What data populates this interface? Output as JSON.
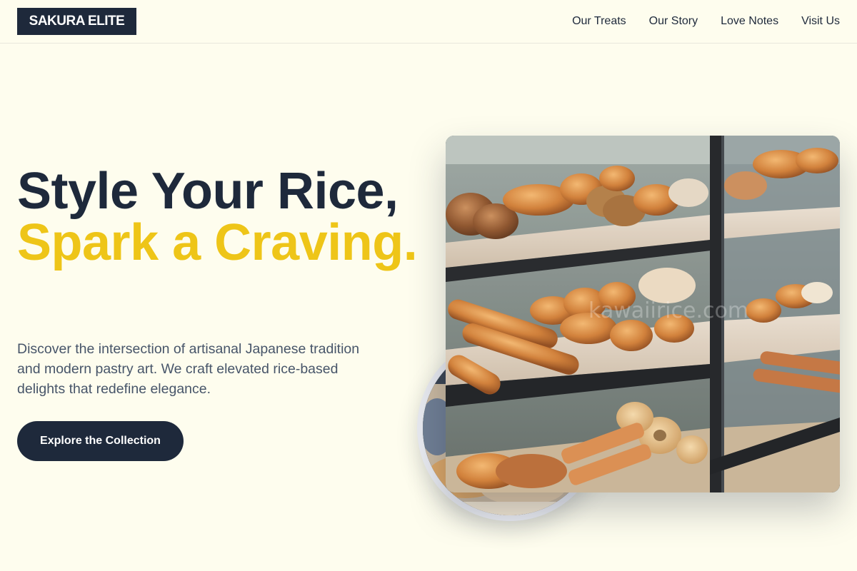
{
  "header": {
    "logo": "SAKURA ELITE",
    "nav": [
      "Our Treats",
      "Our Story",
      "Love Notes",
      "Visit Us"
    ]
  },
  "hero": {
    "title_line1": "Style Your Rice,",
    "title_line2": "Spark a Craving.",
    "description": "Discover the intersection of artisanal Japanese tradition and modern pastry art. We craft elevated rice-based delights that redefine elegance.",
    "cta_label": "Explore the Collection"
  },
  "images": {
    "main_watermark": "kawaiirice.com"
  },
  "colors": {
    "background": "#fefdee",
    "navy": "#1e293b",
    "accent_yellow": "#eec518",
    "body_text": "#475569"
  }
}
